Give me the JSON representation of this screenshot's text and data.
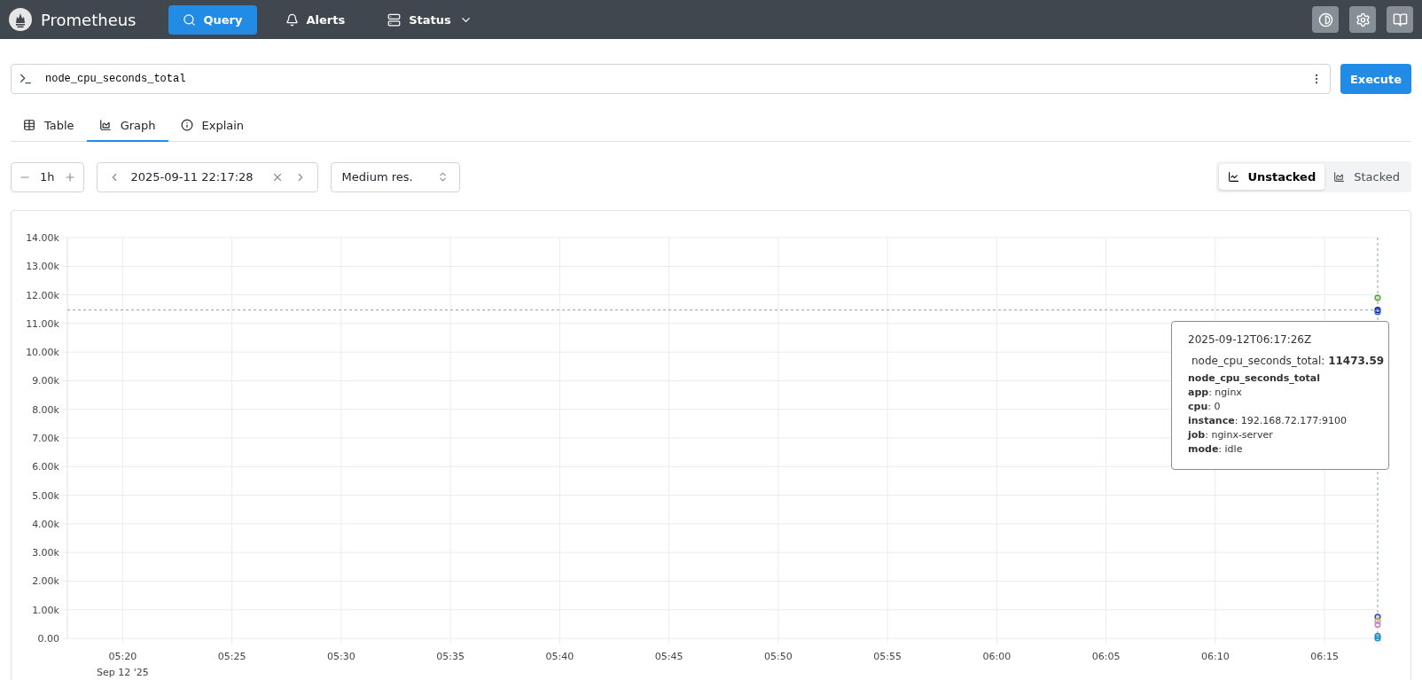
{
  "navbar": {
    "brand": "Prometheus",
    "items": [
      {
        "label": "Query",
        "selected": true
      },
      {
        "label": "Alerts",
        "selected": false
      },
      {
        "label": "Status",
        "selected": false,
        "dropdown": true
      }
    ]
  },
  "query": {
    "value": "node_cpu_seconds_total",
    "button": "Execute"
  },
  "tabs": [
    {
      "label": "Table",
      "selected": false
    },
    {
      "label": "Graph",
      "selected": true
    },
    {
      "label": "Explain",
      "selected": false
    }
  ],
  "controls": {
    "range": "1h",
    "end_time": "2025-09-11 22:17:28",
    "resolution": "Medium res.",
    "modes": [
      {
        "label": "Unstacked",
        "selected": true
      },
      {
        "label": "Stacked",
        "selected": false
      }
    ]
  },
  "graph": {
    "chart_data": {
      "type": "scatter",
      "grid": true,
      "ref_lines": [
        {
          "axis": "y",
          "value": 11470
        },
        {
          "axis": "x",
          "value": 377.43
        }
      ],
      "x": [
        377.43
      ],
      "xlim": [
        317.47,
        377.43
      ],
      "ylim": [
        0,
        14000
      ],
      "xticks": [
        {
          "value": 320,
          "label": "05:20"
        },
        {
          "value": 325,
          "label": "05:25"
        },
        {
          "value": 330,
          "label": "05:30"
        },
        {
          "value": 335,
          "label": "05:35"
        },
        {
          "value": 340,
          "label": "05:40"
        },
        {
          "value": 345,
          "label": "05:45"
        },
        {
          "value": 350,
          "label": "05:50"
        },
        {
          "value": 355,
          "label": "05:55"
        },
        {
          "value": 360,
          "label": "06:00"
        },
        {
          "value": 365,
          "label": "06:05"
        },
        {
          "value": 370,
          "label": "06:10"
        },
        {
          "value": 375,
          "label": "06:15"
        }
      ],
      "yticks": [
        {
          "value": 0,
          "label": "0.00"
        },
        {
          "value": 1000,
          "label": "1.00k"
        },
        {
          "value": 2000,
          "label": "2.00k"
        },
        {
          "value": 3000,
          "label": "3.00k"
        },
        {
          "value": 4000,
          "label": "4.00k"
        },
        {
          "value": 5000,
          "label": "5.00k"
        },
        {
          "value": 6000,
          "label": "6.00k"
        },
        {
          "value": 7000,
          "label": "7.00k"
        },
        {
          "value": 8000,
          "label": "8.00k"
        },
        {
          "value": 9000,
          "label": "9.00k"
        },
        {
          "value": 10000,
          "label": "10.00k"
        },
        {
          "value": 11000,
          "label": "11.00k"
        },
        {
          "value": 12000,
          "label": "12.00k"
        },
        {
          "value": 13000,
          "label": "13.00k"
        },
        {
          "value": 14000,
          "label": "14.00k"
        }
      ],
      "series": [
        {
          "color": "#3300cc",
          "values": [
            11470
          ]
        },
        {
          "color": "#55aa33",
          "values": [
            11900
          ]
        },
        {
          "color": "#2a7ab0",
          "values": [
            11400
          ]
        },
        {
          "color": "#3344bb",
          "values": [
            750
          ]
        },
        {
          "color": "#c8b060",
          "values": [
            600
          ]
        },
        {
          "color": "#cc88cc",
          "values": [
            480
          ]
        },
        {
          "color": "#1a9aaa",
          "values": [
            80
          ]
        },
        {
          "color": "#2288dd",
          "values": [
            0
          ]
        }
      ]
    },
    "date_label": "Sep 12 '25",
    "tooltip": {
      "time": "2025-09-12T06:17:26Z",
      "series_line": "node_cpu_seconds_total: **11473.59**",
      "metric": "node_cpu_seconds_total",
      "labels": [
        "**app**: nginx",
        "**cpu**: 0",
        "**instance**: 192.168.72.177:9100",
        "**job**: nginx-server",
        "**mode**: idle"
      ]
    }
  }
}
